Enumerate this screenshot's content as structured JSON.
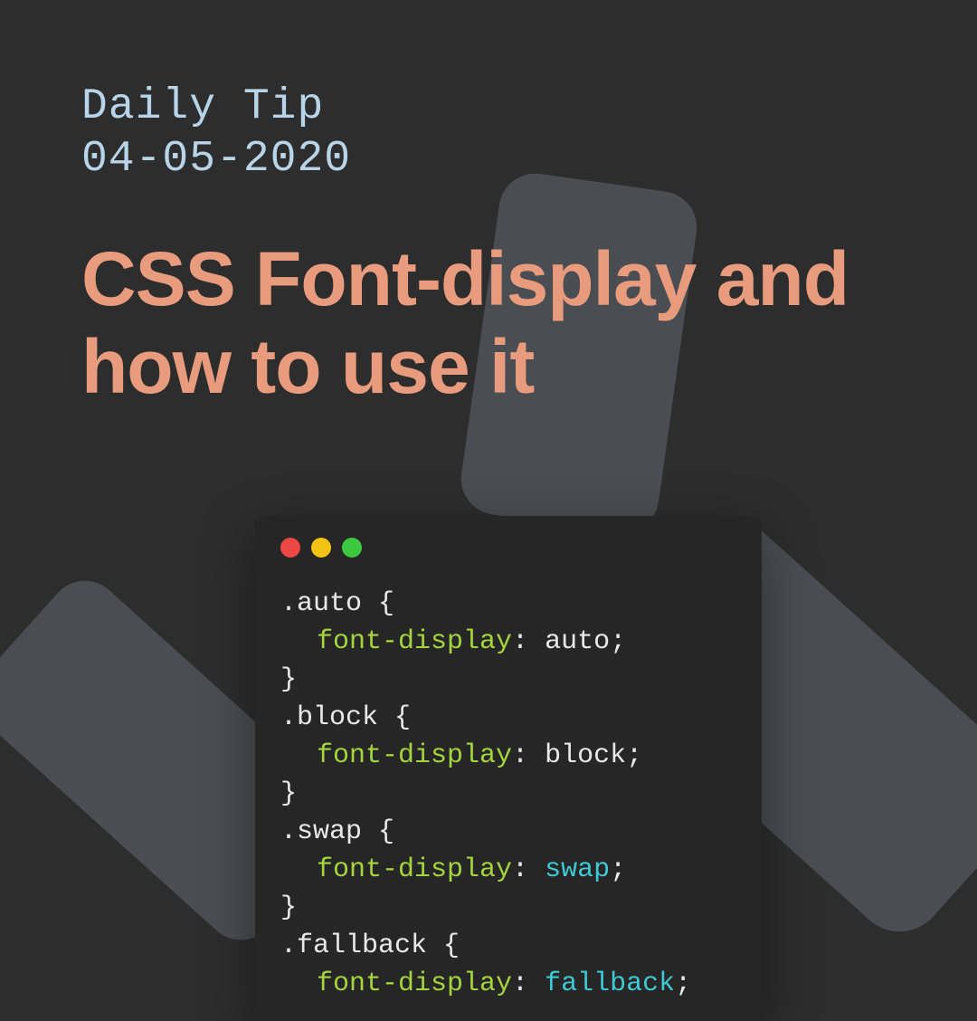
{
  "header": {
    "tip_label": "Daily Tip",
    "date": "04-05-2020",
    "title": "CSS Font-display and how to use it"
  },
  "code": {
    "rules": [
      {
        "selector": ".auto",
        "property": "font-display",
        "value": "auto",
        "value_class": "value-auto"
      },
      {
        "selector": ".block",
        "property": "font-display",
        "value": "block",
        "value_class": "value-block"
      },
      {
        "selector": ".swap",
        "property": "font-display",
        "value": "swap",
        "value_class": "value-swap"
      },
      {
        "selector": ".fallback",
        "property": "font-display",
        "value": "fallback",
        "value_class": "value-fallback"
      }
    ]
  },
  "colors": {
    "bg": "#2d2d2d",
    "shape": "#4a4e52",
    "tip_label": "#b8d4e8",
    "title": "#e89b7d",
    "code_bg": "#262626",
    "selector": "#e8e8e8",
    "property": "#a4d43e",
    "value_highlight": "#3fc9d4",
    "dot_red": "#ed4745",
    "dot_yellow": "#f4c213",
    "dot_green": "#3cc83f"
  }
}
